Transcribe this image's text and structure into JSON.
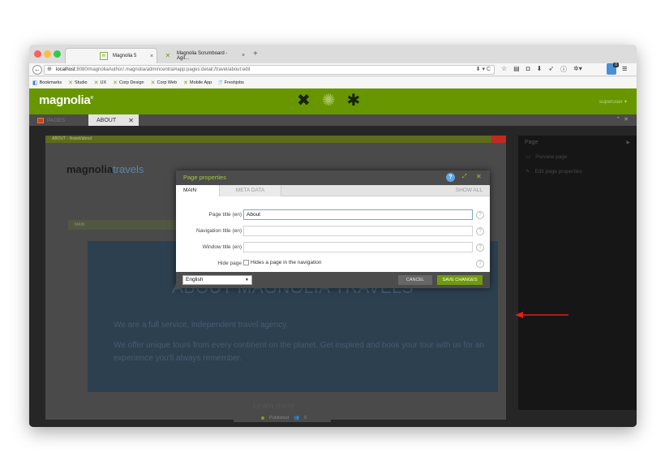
{
  "browser": {
    "tabs": [
      {
        "label": "Magnolia 5",
        "close": "×"
      },
      {
        "label": "Magnolia Scrumboard - Agil...",
        "close": "×"
      }
    ],
    "new_tab": "+",
    "url_host": "localhost",
    "url_rest": ":8080/magnoliaAuthor/.magnolia/admincentral#app:pages:detail;/travel/about:edit",
    "bookmarks": [
      "Bookmarks",
      "Studio",
      "UX",
      "Corp Design",
      "Corp Web",
      "Mobile App",
      "Freshjobs"
    ],
    "extension_badge": "0"
  },
  "app": {
    "logo": "magnolia",
    "user": "superuser ▾",
    "tabs": {
      "pages": "PAGES",
      "about": "ABOUT"
    }
  },
  "preview": {
    "breadcrumb": "ABOUT - /travel/about",
    "site_logo_main": "magnolia",
    "site_logo_sub": "travels",
    "nav_bar": "MAIN",
    "hero_title": "ABOUT MAGNOLIA TRAVELS",
    "hero_line1": "We are a full service, independent travel agency.",
    "hero_line2": "We offer unique tours from every continent on the planet. Get inspired and book your tour with us for an experience you'll always remember.",
    "learn_more": "Learn more",
    "status": "Published",
    "status_count": "0"
  },
  "action_panel": {
    "title": "Page",
    "items": [
      "Preview page",
      "Edit page properties"
    ]
  },
  "dialog": {
    "title": "Page properties",
    "help": "?",
    "tabs": {
      "main": "MAIN",
      "meta": "META DATA",
      "show_all": "SHOW ALL"
    },
    "fields": [
      {
        "label": "Page title (en)",
        "value": "About"
      },
      {
        "label": "Navigation title (en)",
        "value": ""
      },
      {
        "label": "Window title (en)",
        "value": ""
      }
    ],
    "hide_page": {
      "label": "Hide page",
      "checkbox_text": "Hides a page in the navigation",
      "checked": false
    },
    "language": "English",
    "cancel": "CANCEL",
    "save": "SAVE CHANGES"
  },
  "colors": {
    "brand_green": "#689600",
    "save_green": "#6f9b0a",
    "annotation_arrow": "#e0201b"
  }
}
